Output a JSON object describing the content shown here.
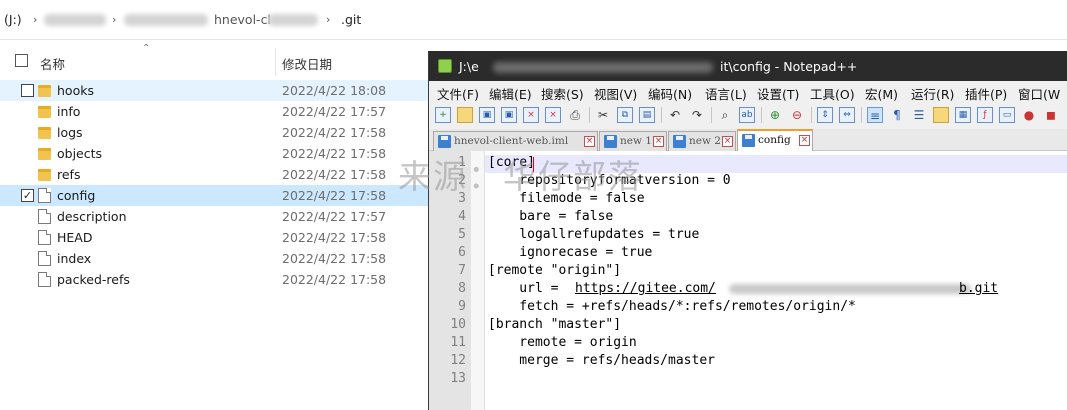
{
  "explorer": {
    "address": {
      "drive": "(J:)",
      "segment_partial": "hnevol-cl",
      "last": ".git"
    },
    "columns": {
      "name": "名称",
      "date": "修改日期"
    },
    "items": [
      {
        "name": "hooks",
        "date": "2022/4/22 18:08",
        "type": "folder"
      },
      {
        "name": "info",
        "date": "2022/4/22 17:57",
        "type": "folder"
      },
      {
        "name": "logs",
        "date": "2022/4/22 17:58",
        "type": "folder"
      },
      {
        "name": "objects",
        "date": "2022/4/22 17:58",
        "type": "folder"
      },
      {
        "name": "refs",
        "date": "2022/4/22 17:58",
        "type": "folder"
      },
      {
        "name": "config",
        "date": "2022/4/22 17:58",
        "type": "file",
        "checked": true
      },
      {
        "name": "description",
        "date": "2022/4/22 17:57",
        "type": "file"
      },
      {
        "name": "HEAD",
        "date": "2022/4/22 17:58",
        "type": "file"
      },
      {
        "name": "index",
        "date": "2022/4/22 17:58",
        "type": "file"
      },
      {
        "name": "packed-refs",
        "date": "2022/4/22 17:58",
        "type": "file"
      }
    ],
    "checkmark": "✓"
  },
  "notepad": {
    "title_start": "J:\\e",
    "title_end": "it\\config - Notepad++",
    "menu": [
      "文件(F)",
      "编辑(E)",
      "搜索(S)",
      "视图(V)",
      "编码(N)",
      "语言(L)",
      "设置(T)",
      "工具(O)",
      "宏(M)",
      "运行(R)",
      "插件(P)",
      "窗口(W"
    ],
    "tabs": [
      {
        "label": "hnevol-client-web.iml",
        "active": false
      },
      {
        "label": "new 1",
        "active": false
      },
      {
        "label": "new 2",
        "active": false
      },
      {
        "label": "config",
        "active": true
      }
    ],
    "tab_close": "×",
    "lines": [
      {
        "n": "1",
        "text": "[core]"
      },
      {
        "n": "2",
        "text": "    repositoryformatversion = 0"
      },
      {
        "n": "3",
        "text": "    filemode = false"
      },
      {
        "n": "4",
        "text": "    bare = false"
      },
      {
        "n": "5",
        "text": "    logallrefupdates = true"
      },
      {
        "n": "6",
        "text": "    ignorecase = true"
      },
      {
        "n": "7",
        "text": "[remote \"origin\"]"
      },
      {
        "n": "8",
        "text": "    url = ",
        "link_start": "https://gitee.com/",
        "link_end": "b.git"
      },
      {
        "n": "9",
        "text": "    fetch = +refs/heads/*:refs/remotes/origin/*"
      },
      {
        "n": "10",
        "text": "[branch \"master\"]"
      },
      {
        "n": "11",
        "text": "    remote = origin"
      },
      {
        "n": "12",
        "text": "    merge = refs/heads/master"
      },
      {
        "n": "13",
        "text": ""
      }
    ]
  },
  "watermark": "来源：华仔部落",
  "colors": {
    "selected_row": "#cce8ff",
    "hover_row": "#e5f3ff",
    "titlebar": "#2b2b2b",
    "active_tab_accent": "#f39c32",
    "folder": "#f3c44d"
  }
}
